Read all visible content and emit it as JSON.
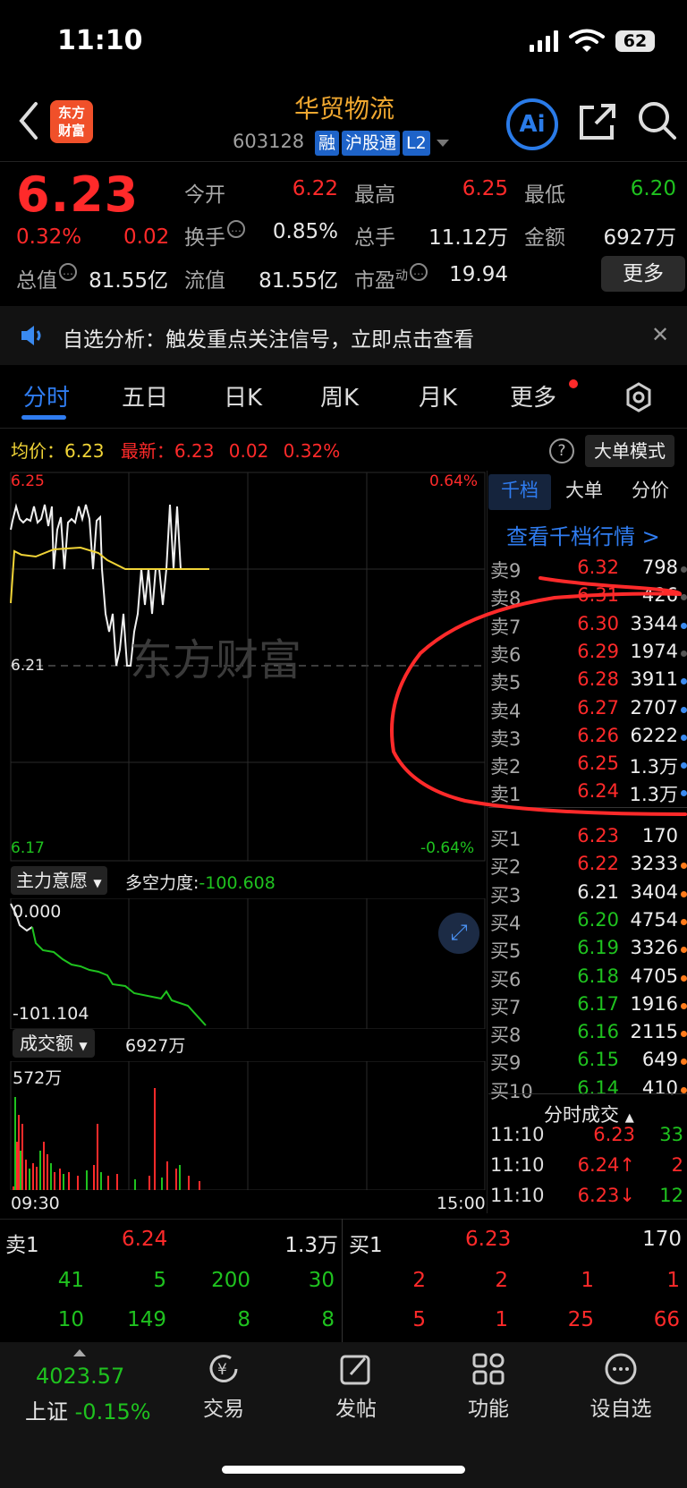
{
  "status": {
    "time": "11:10",
    "battery": "62"
  },
  "header": {
    "logo_line1": "东方",
    "logo_line2": "财富",
    "stock_name": "华贸物流",
    "stock_code": "603128",
    "tags": [
      "融",
      "沪股通",
      "L2"
    ],
    "ai_label": "Ai"
  },
  "quote": {
    "price": "6.23",
    "change_pct": "0.32%",
    "change": "0.02",
    "open_label": "今开",
    "open": "6.22",
    "high_label": "最高",
    "high": "6.25",
    "low_label": "最低",
    "low": "6.20",
    "turnover_label": "换手",
    "turnover": "0.85%",
    "volume_label": "总手",
    "volume": "11.12万",
    "amount_label": "金额",
    "amount": "6927万",
    "mktcap_label": "总值",
    "mktcap": "81.55亿",
    "float_label": "流值",
    "float": "81.55亿",
    "pe_label": "市盈",
    "pe_sup": "动",
    "pe": "19.94",
    "more": "更多"
  },
  "banner": {
    "text": "自选分析：触发重点关注信号，立即点击查看"
  },
  "tabs": [
    "分时",
    "五日",
    "日K",
    "周K",
    "月K",
    "更多"
  ],
  "chart": {
    "avg_label": "均价：",
    "avg": "6.23",
    "latest_label": "最新：",
    "latest": "6.23",
    "latest_change": "0.02",
    "latest_pct": "0.32%",
    "help": "?",
    "big_order_mode": "大单模式",
    "y_top": "6.25",
    "y_mid": "6.21",
    "y_bottom": "6.17",
    "pct_top": "0.64%",
    "pct_bottom": "-0.64%",
    "watermark": "东方财富",
    "indicator_label": "主力意愿",
    "indicator_name": "多空力度:",
    "indicator_value": "-100.608",
    "ind_top": "0.000",
    "ind_bottom": "-101.104",
    "volume_label": "成交额",
    "volume_value": "6927万",
    "vol_max": "572万",
    "time_start": "09:30",
    "time_end": "15:00"
  },
  "orderbook": {
    "tabs": [
      "千档",
      "大单",
      "分价"
    ],
    "view_depth": "查看千档行情 >",
    "asks": [
      {
        "side": "卖9",
        "price": "6.32",
        "vol": "798",
        "dot": "#555555"
      },
      {
        "side": "卖8",
        "price": "6.31",
        "vol": "426",
        "dot": "#555555"
      },
      {
        "side": "卖7",
        "price": "6.30",
        "vol": "3344",
        "dot": "#3a8af0"
      },
      {
        "side": "卖6",
        "price": "6.29",
        "vol": "1974",
        "dot": "#555555"
      },
      {
        "side": "卖5",
        "price": "6.28",
        "vol": "3911",
        "dot": "#3a8af0"
      },
      {
        "side": "卖4",
        "price": "6.27",
        "vol": "2707",
        "dot": "#3a8af0"
      },
      {
        "side": "卖3",
        "price": "6.26",
        "vol": "6222",
        "dot": "#3a8af0"
      },
      {
        "side": "卖2",
        "price": "6.25",
        "vol": "1.3万",
        "dot": "#3a8af0"
      },
      {
        "side": "卖1",
        "price": "6.24",
        "vol": "1.3万",
        "dot": "#3a8af0"
      }
    ],
    "bids": [
      {
        "side": "买1",
        "price": "6.23",
        "vol": "170",
        "color": "#ff2a2a",
        "dot": ""
      },
      {
        "side": "买2",
        "price": "6.22",
        "vol": "3233",
        "color": "#ff2a2a",
        "dot": "#ff7a1a"
      },
      {
        "side": "买3",
        "price": "6.21",
        "vol": "3404",
        "color": "#e8e8e8",
        "dot": "#ff7a1a"
      },
      {
        "side": "买4",
        "price": "6.20",
        "vol": "4754",
        "color": "#1fc21f",
        "dot": "#ff7a1a"
      },
      {
        "side": "买5",
        "price": "6.19",
        "vol": "3326",
        "color": "#1fc21f",
        "dot": "#ff7a1a"
      },
      {
        "side": "买6",
        "price": "6.18",
        "vol": "4705",
        "color": "#1fc21f",
        "dot": "#ff7a1a"
      },
      {
        "side": "买7",
        "price": "6.17",
        "vol": "1916",
        "color": "#1fc21f",
        "dot": "#ff7a1a"
      },
      {
        "side": "买8",
        "price": "6.16",
        "vol": "2115",
        "color": "#1fc21f",
        "dot": "#ff7a1a"
      },
      {
        "side": "买9",
        "price": "6.15",
        "vol": "649",
        "color": "#1fc21f",
        "dot": "#ff7a1a"
      },
      {
        "side": "买10",
        "price": "6.14",
        "vol": "410",
        "color": "#1fc21f",
        "dot": "#ff7a1a"
      }
    ],
    "ticks_title": "分时成交",
    "ticks": [
      {
        "time": "11:10",
        "price": "6.23",
        "vol": "33",
        "vcolor": "#1fc21f"
      },
      {
        "time": "11:10",
        "price": "6.24↑",
        "vol": "2",
        "vcolor": "#ff2a2a"
      },
      {
        "time": "11:10",
        "price": "6.23↓",
        "vol": "12",
        "vcolor": "#1fc21f"
      }
    ]
  },
  "summary": {
    "sell_label": "卖1",
    "sell_price": "6.24",
    "sell_vol": "1.3万",
    "buy_label": "买1",
    "buy_price": "6.23",
    "buy_vol": "170",
    "sell_row1": [
      "41",
      "5",
      "200",
      "30"
    ],
    "sell_row2": [
      "10",
      "149",
      "8",
      "8"
    ],
    "buy_row1": [
      "2",
      "2",
      "1",
      "1"
    ],
    "buy_row2": [
      "5",
      "1",
      "25",
      "66"
    ]
  },
  "nav": {
    "index_value": "4023.57",
    "index_name": "上证",
    "index_change": "-0.15%",
    "items": [
      "交易",
      "发帖",
      "功能",
      "设自选"
    ]
  }
}
